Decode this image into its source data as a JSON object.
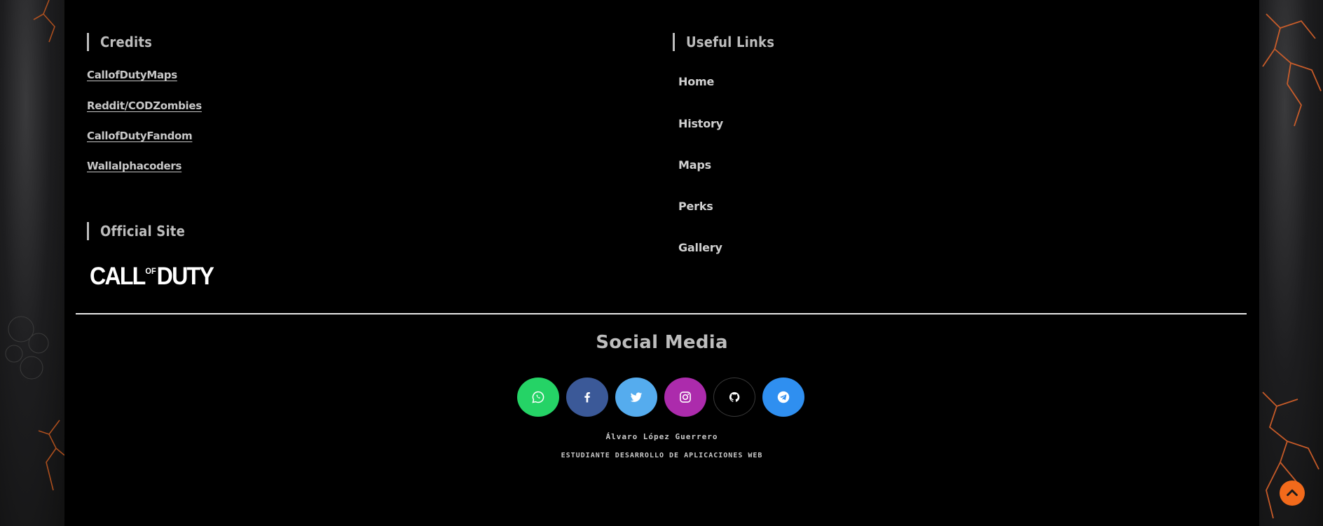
{
  "credits": {
    "title": "Credits",
    "links": [
      "CallofDutyMaps",
      "Reddit/CODZombies",
      "CallofDutyFandom",
      "Wallalphacoders"
    ]
  },
  "official": {
    "title": "Official Site",
    "logo": {
      "main1": "CALL",
      "of": "OF",
      "main2": "DUTY"
    }
  },
  "useful": {
    "title": "Useful Links",
    "links": [
      "Home",
      "History",
      "Maps",
      "Perks",
      "Gallery"
    ]
  },
  "social": {
    "title": "Social Media",
    "buttons": [
      {
        "icon": "whatsapp-icon",
        "color": "#25d366"
      },
      {
        "icon": "facebook-icon",
        "color": "#3b5998"
      },
      {
        "icon": "twitter-icon",
        "color": "#55acee"
      },
      {
        "icon": "instagram-icon",
        "color": "#ac2bac"
      },
      {
        "icon": "github-icon",
        "color": "#000000"
      },
      {
        "icon": "telegram-icon",
        "color": "#2f8ff0"
      }
    ]
  },
  "author": {
    "name": "Álvaro López Guerrero",
    "role": "ESTUDIANTE DESARROLLO DE APLICACIONES WEB"
  },
  "colors": {
    "accent": "#f26a1b",
    "text": "#bdbdbd",
    "background": "#000000"
  }
}
